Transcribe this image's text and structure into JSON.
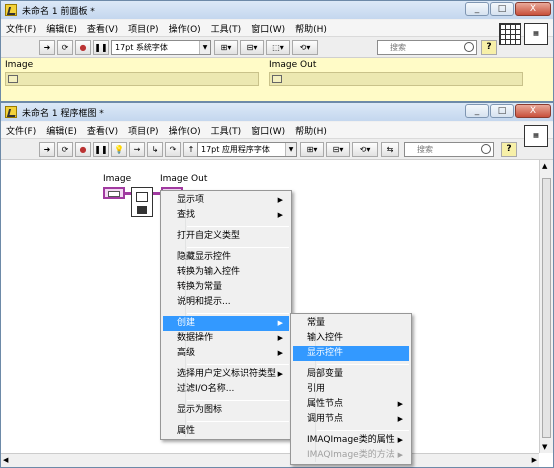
{
  "front_panel": {
    "title": "未命名 1 前面板 *",
    "window_buttons": [
      "_",
      "□",
      "X"
    ],
    "menu": [
      "文件(F)",
      "编辑(E)",
      "查看(V)",
      "项目(P)",
      "操作(O)",
      "工具(T)",
      "窗口(W)",
      "帮助(H)"
    ],
    "font": "17pt 系统字体",
    "search_placeholder": "搜索",
    "help": "?",
    "controls": [
      {
        "label": "Image"
      },
      {
        "label": "Image Out"
      }
    ]
  },
  "block_diagram": {
    "title": "未命名 1 程序框图 *",
    "window_buttons": [
      "_",
      "□",
      "X"
    ],
    "menu": [
      "文件(F)",
      "编辑(E)",
      "查看(V)",
      "项目(P)",
      "操作(O)",
      "工具(T)",
      "窗口(W)",
      "帮助(H)"
    ],
    "font": "17pt 应用程序字体",
    "search_placeholder": "搜索",
    "help": "?",
    "nodes": [
      {
        "label": "Image"
      },
      {
        "label": "Image Out"
      }
    ]
  },
  "context_menu": {
    "items": [
      {
        "label": "显示项",
        "submenu": true
      },
      {
        "label": "查找",
        "submenu": true
      },
      {
        "label": "打开自定义类型"
      },
      {
        "label": "隐藏显示控件"
      },
      {
        "label": "转换为输入控件"
      },
      {
        "label": "转换为常量"
      },
      {
        "label": "说明和提示..."
      },
      {
        "label": "创建",
        "submenu": true,
        "highlighted": true
      },
      {
        "label": "数据操作",
        "submenu": true
      },
      {
        "label": "高级",
        "submenu": true
      },
      {
        "label": "选择用户定义标识符类型",
        "submenu": true
      },
      {
        "label": "过滤I/O名称..."
      },
      {
        "label": "显示为图标"
      },
      {
        "label": "属性"
      }
    ]
  },
  "submenu": {
    "items": [
      {
        "label": "常量"
      },
      {
        "label": "输入控件"
      },
      {
        "label": "显示控件",
        "highlighted": true
      },
      {
        "label": "局部变量"
      },
      {
        "label": "引用"
      },
      {
        "label": "属性节点",
        "submenu": true
      },
      {
        "label": "调用节点",
        "submenu": true
      },
      {
        "label": "IMAQImage类的属性",
        "submenu": true
      },
      {
        "label": "IMAQImage类的方法",
        "submenu": true,
        "disabled": true
      }
    ]
  },
  "colors": {
    "front_panel_bg": "#fffbc7",
    "wire": "#a13aa0",
    "highlight": "#3399ff"
  }
}
